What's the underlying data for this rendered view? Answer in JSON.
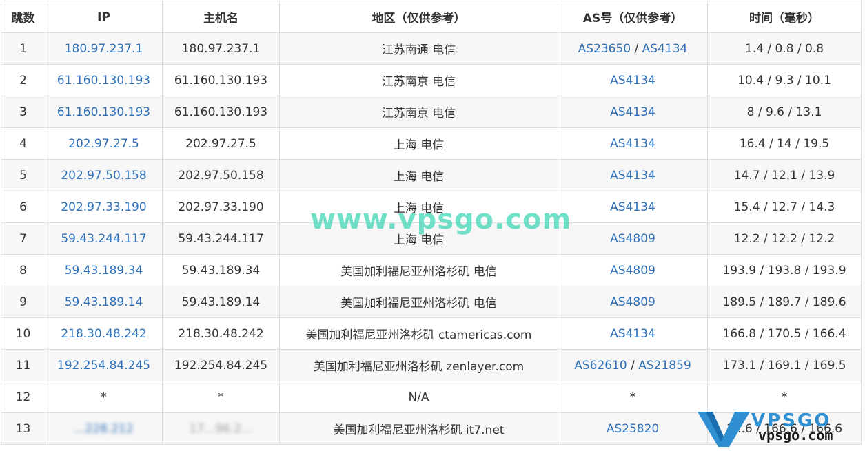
{
  "headers": [
    "跳数",
    "IP",
    "主机名",
    "地区（仅供参考）",
    "AS号（仅供参考）",
    "时间（毫秒）"
  ],
  "rows": [
    {
      "hop": "1",
      "ip": "180.97.237.1",
      "host": "180.97.237.1",
      "region": "江苏南通 电信",
      "as": [
        "AS23650",
        "AS4134"
      ],
      "time": "1.4 / 0.8 / 0.8"
    },
    {
      "hop": "2",
      "ip": "61.160.130.193",
      "host": "61.160.130.193",
      "region": "江苏南京 电信",
      "as": [
        "AS4134"
      ],
      "time": "10.4 / 9.3 / 10.1"
    },
    {
      "hop": "3",
      "ip": "61.160.130.193",
      "host": "61.160.130.193",
      "region": "江苏南京 电信",
      "as": [
        "AS4134"
      ],
      "time": "8 / 9.6 / 13.1"
    },
    {
      "hop": "4",
      "ip": "202.97.27.5",
      "host": "202.97.27.5",
      "region": "上海 电信",
      "as": [
        "AS4134"
      ],
      "time": "16.4 / 14 / 19.5"
    },
    {
      "hop": "5",
      "ip": "202.97.50.158",
      "host": "202.97.50.158",
      "region": "上海 电信",
      "as": [
        "AS4134"
      ],
      "time": "14.7 / 12.1 / 13.9"
    },
    {
      "hop": "6",
      "ip": "202.97.33.190",
      "host": "202.97.33.190",
      "region": "上海 电信",
      "as": [
        "AS4134"
      ],
      "time": "15.4 / 12.7 / 14.3"
    },
    {
      "hop": "7",
      "ip": "59.43.244.117",
      "host": "59.43.244.117",
      "region": "上海 电信",
      "as": [
        "AS4809"
      ],
      "time": "12.2 / 12.2 / 12.2"
    },
    {
      "hop": "8",
      "ip": "59.43.189.34",
      "host": "59.43.189.34",
      "region": "美国加利福尼亚州洛杉矶 电信",
      "as": [
        "AS4809"
      ],
      "time": "193.9 / 193.8 / 193.9"
    },
    {
      "hop": "9",
      "ip": "59.43.189.14",
      "host": "59.43.189.14",
      "region": "美国加利福尼亚州洛杉矶 电信",
      "as": [
        "AS4809"
      ],
      "time": "189.5 / 189.7 / 189.6"
    },
    {
      "hop": "10",
      "ip": "218.30.48.242",
      "host": "218.30.48.242",
      "region": "美国加利福尼亚州洛杉矶 ctamericas.com",
      "as": [
        "AS4134"
      ],
      "time": "166.8 / 170.5 / 166.4"
    },
    {
      "hop": "11",
      "ip": "192.254.84.245",
      "host": "192.254.84.245",
      "region": "美国加利福尼亚州洛杉矶 zenlayer.com",
      "as": [
        "AS62610",
        "AS21859"
      ],
      "time": "173.1 / 169.1 / 169.5"
    },
    {
      "hop": "12",
      "ip": "*",
      "host": "*",
      "region": "N/A",
      "as": [
        "*"
      ],
      "time": "*"
    },
    {
      "hop": "13",
      "ip": "...228.212",
      "host": "17...96.2...",
      "region": "美国加利福尼亚州洛杉矶 it7.net",
      "as": [
        "AS25820"
      ],
      "time": "1...6 / 166.6 / 166.6"
    }
  ],
  "watermark": "www.vpsgo.com",
  "logo": {
    "top": "VPSGO",
    "bottom": "vpsgo.com",
    "color": "#2f8fd1"
  },
  "colors": {
    "link": "#2f6fb6",
    "border": "#dddddd",
    "stripe": "#f7f7f7"
  }
}
